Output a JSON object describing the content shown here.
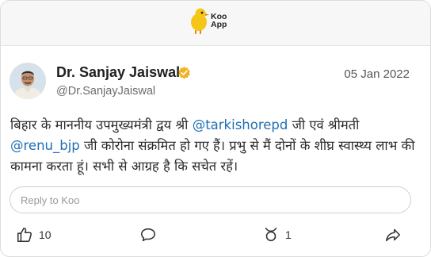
{
  "app": {
    "logo_line1": "Koo",
    "logo_line2": "App"
  },
  "post": {
    "author_name": "Dr. Sanjay Jaiswal",
    "handle": "@Dr.SanjayJaiswal",
    "date": "05 Jan 2022",
    "text_part1": "बिहार के माननीय उपमुख्यमंत्री द्वय श्री ",
    "mention1": "@tarkishorepd",
    "text_part2": " जी एवं श्रीमती ",
    "mention2": "@renu_bjp",
    "text_part3": " जी कोरोना संक्रमित हो गए हैं। प्रभु से मैं दोनों के शीघ्र स्वास्थ्य लाभ की कामना करता हूं। सभी से आग्रह है कि सचेत रहें।"
  },
  "reply": {
    "placeholder": "Reply to Koo"
  },
  "actions": {
    "like_count": "10",
    "rekoo_count": "1"
  },
  "icons": {
    "logo": "koo-bird-logo",
    "verified": "verified-badge-icon",
    "like": "thumbs-up-icon",
    "comment": "comment-bubble-icon",
    "rekoo": "rekoo-icon",
    "share": "share-arrow-icon"
  },
  "colors": {
    "brand_yellow": "#f5c518",
    "mention_blue": "#1f6fb2",
    "verified_gold": "#f0b323"
  }
}
